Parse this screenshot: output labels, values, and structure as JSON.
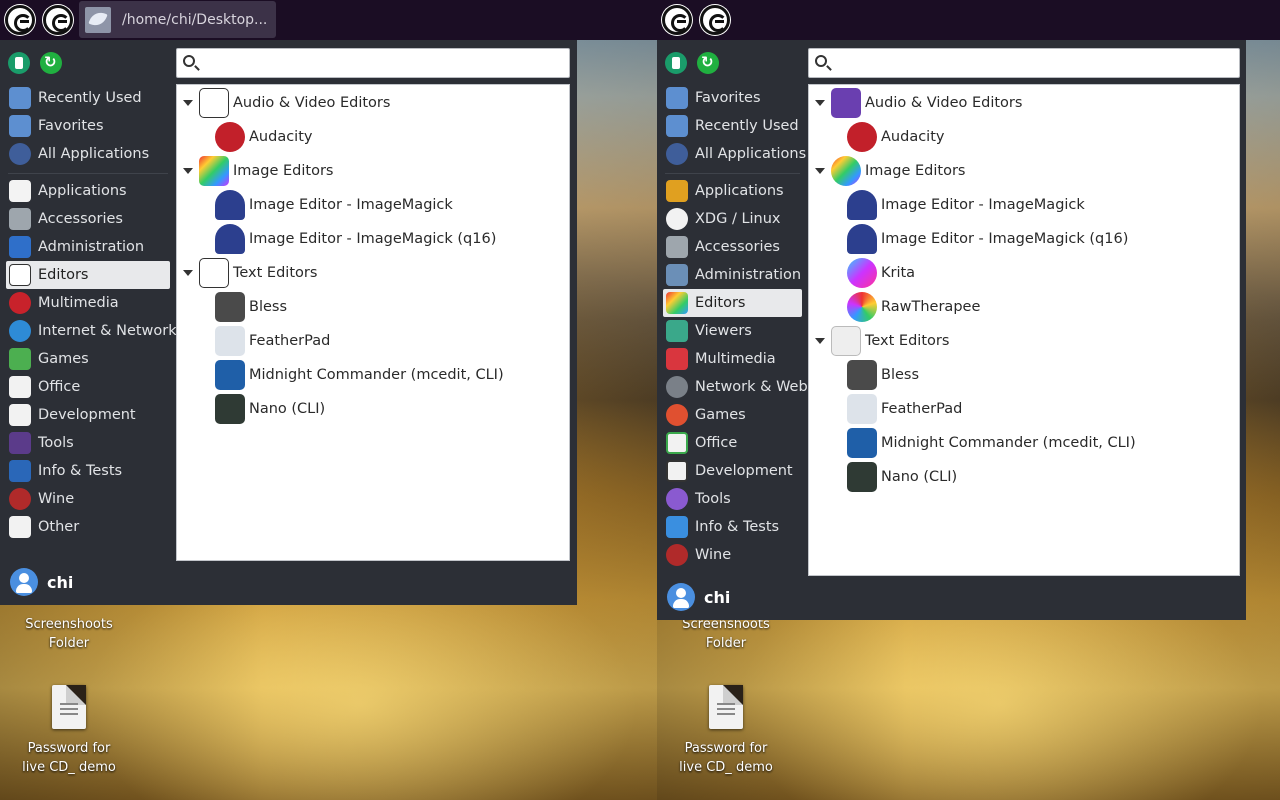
{
  "left": {
    "taskbar": {
      "window_title": "/home/chi/Desktop..."
    },
    "search": {
      "value": "",
      "placeholder": ""
    },
    "sidebar": {
      "top": [
        "Recently Used",
        "Favorites",
        "All Applications"
      ],
      "categories": [
        "Applications",
        "Accessories",
        "Administration",
        "Editors",
        "Multimedia",
        "Internet & Network",
        "Games",
        "Office",
        "Development",
        "Tools",
        "Info & Tests",
        "Wine",
        "Other"
      ],
      "selected": "Editors"
    },
    "tree": [
      {
        "group": "Audio & Video Editors",
        "items": [
          "Audacity"
        ]
      },
      {
        "group": "Image Editors",
        "items": [
          "Image Editor - ImageMagick",
          "Image Editor - ImageMagick (q16)"
        ]
      },
      {
        "group": "Text Editors",
        "items": [
          "Bless",
          "FeatherPad",
          "Midnight Commander (mcedit, CLI)",
          "Nano (CLI)"
        ]
      }
    ],
    "user": "chi"
  },
  "right": {
    "search": {
      "value": "",
      "placeholder": ""
    },
    "sidebar": {
      "top": [
        "Favorites",
        "Recently Used",
        "All Applications"
      ],
      "categories": [
        "Applications",
        "XDG / Linux",
        "Accessories",
        "Administration",
        "Editors",
        "Viewers",
        "Multimedia",
        "Network & Web",
        "Games",
        "Office",
        "Development",
        "Tools",
        "Info & Tests",
        "Wine"
      ],
      "selected": "Editors"
    },
    "tree": [
      {
        "group": "Audio & Video Editors",
        "items": [
          "Audacity"
        ]
      },
      {
        "group": "Image Editors",
        "items": [
          "Image Editor - ImageMagick",
          "Image Editor - ImageMagick (q16)",
          "Krita",
          "RawTherapee"
        ]
      },
      {
        "group": "Text Editors",
        "items": [
          "Bless",
          "FeatherPad",
          "Midnight Commander (mcedit, CLI)",
          "Nano (CLI)"
        ]
      }
    ],
    "user": "chi"
  },
  "desktop": {
    "folder_label_line1": "Screenshoots",
    "folder_label_line2": "Folder",
    "file_label_line1": "Password for",
    "file_label_line2": "live CD_ demo"
  },
  "colors": {
    "panel": "#1b0d24",
    "menu": "#2c2f36",
    "selected": "#e8e9eb"
  }
}
